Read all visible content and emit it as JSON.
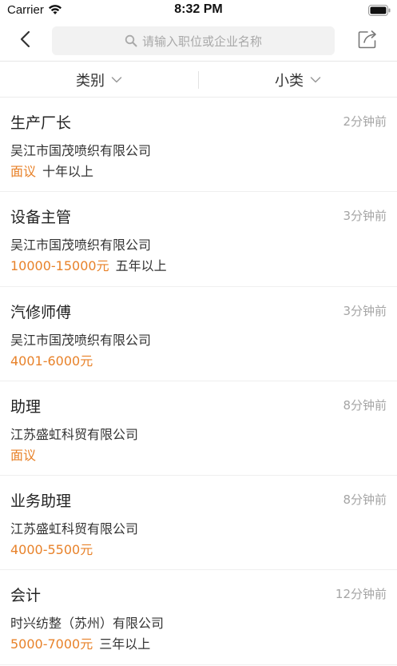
{
  "status_bar": {
    "carrier": "Carrier",
    "time": "8:32 PM"
  },
  "nav": {
    "back_icon": "chevron-left-icon",
    "search_placeholder": "请输入职位或企业名称",
    "share_icon": "share-icon"
  },
  "filters": [
    {
      "label": "类别"
    },
    {
      "label": "小类"
    }
  ],
  "colors": {
    "accent": "#e8822a",
    "time_gray": "#a5a5a5",
    "divider": "#efefef"
  },
  "jobs": [
    {
      "title": "生产厂长",
      "time": "2分钟前",
      "company": "吴江市国茂喷织有限公司",
      "salary": "面议",
      "experience": "十年以上"
    },
    {
      "title": "设备主管",
      "time": "3分钟前",
      "company": "吴江市国茂喷织有限公司",
      "salary": "10000-15000元",
      "experience": "五年以上"
    },
    {
      "title": "汽修师傅",
      "time": "3分钟前",
      "company": "吴江市国茂喷织有限公司",
      "salary": "4001-6000元",
      "experience": ""
    },
    {
      "title": "助理",
      "time": "8分钟前",
      "company": "江苏盛虹科贸有限公司",
      "salary": "面议",
      "experience": ""
    },
    {
      "title": "业务助理",
      "time": "8分钟前",
      "company": "江苏盛虹科贸有限公司",
      "salary": "4000-5500元",
      "experience": ""
    },
    {
      "title": "会计",
      "time": "12分钟前",
      "company": "时兴纺整（苏州）有限公司",
      "salary": "5000-7000元",
      "experience": "三年以上"
    }
  ]
}
